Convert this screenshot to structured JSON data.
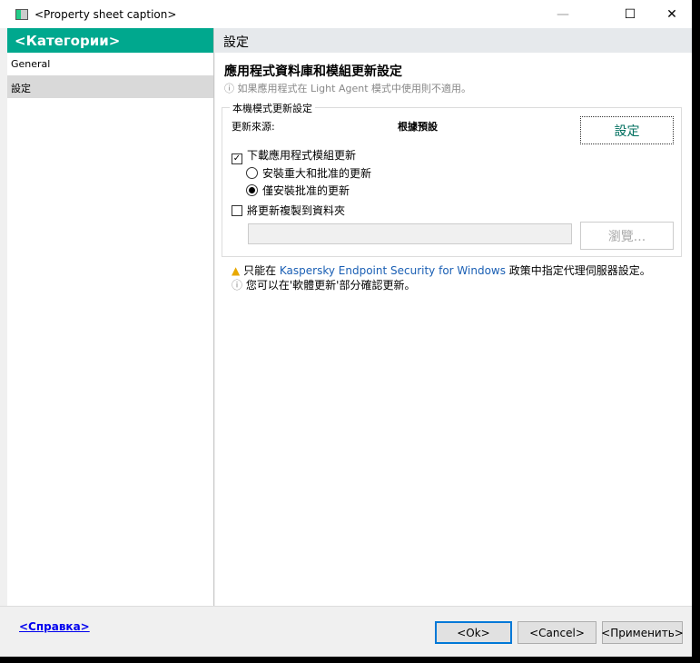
{
  "window": {
    "title": "<Property sheet caption>",
    "minimize": "—",
    "maximize": "☐",
    "close": "✕"
  },
  "sidebar": {
    "header": "<Категории>",
    "items": [
      {
        "label": "General"
      },
      {
        "label": "設定"
      }
    ]
  },
  "main": {
    "header": "設定",
    "title": "應用程式資料庫和模組更新設定",
    "note": "如果應用程式在 Light Agent 模式中使用則不適用。",
    "group": {
      "legend": "本機模式更新設定",
      "source_label": "更新來源:",
      "source_value": "根據預設",
      "settings_button": "設定",
      "download_modules": {
        "label": "下載應用程式模組更新",
        "checked": true
      },
      "radios": [
        {
          "label": "安裝重大和批准的更新",
          "selected": false
        },
        {
          "label": "僅安裝批准的更新",
          "selected": true
        }
      ],
      "copy_to_folder": {
        "label": "將更新複製到資料夾",
        "checked": false
      },
      "folder_value": "",
      "browse_button": "瀏覽..."
    },
    "warning": {
      "pre": "只能在 ",
      "link": "Kaspersky Endpoint Security for Windows",
      "post": " 政策中指定代理伺服器設定。"
    },
    "info": "您可以在'軟體更新'部分確認更新。"
  },
  "footer": {
    "help": "<Справка>",
    "ok": "<Ok>",
    "cancel": "<Cancel>",
    "apply": "<Применить>"
  },
  "colors": {
    "accent": "#00a88e",
    "link": "#1a5fb4"
  }
}
